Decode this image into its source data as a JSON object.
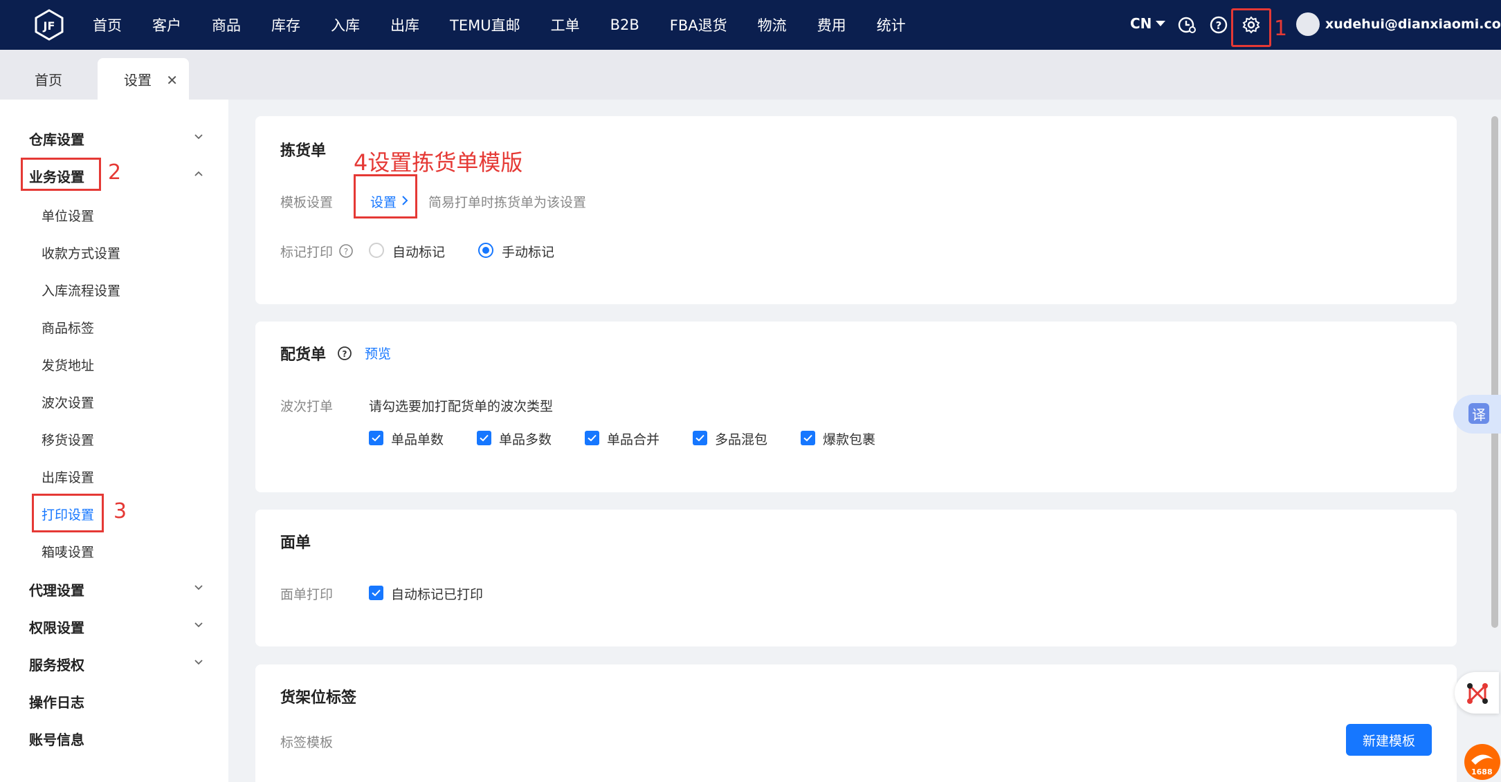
{
  "colors": {
    "nav_bg": "#0b1f4f",
    "accent": "#1677ff",
    "annotation": "#e53935"
  },
  "nav": {
    "logo_icon": "jf-logo-icon",
    "items": [
      "首页",
      "客户",
      "商品",
      "库存",
      "入库",
      "出库",
      "TEMU直邮",
      "工单",
      "B2B",
      "FBA退货",
      "物流",
      "费用",
      "统计"
    ]
  },
  "topright": {
    "lang": "CN",
    "icons": [
      "clock-icon",
      "help-icon",
      "gear-icon"
    ],
    "user": "xudehui@dianxiaomi.com"
  },
  "tabs": {
    "home": "首页",
    "settings": "设置",
    "close": "✕"
  },
  "sidebar": {
    "groups": {
      "warehouse": "仓库设置",
      "business": "业务设置",
      "agent": "代理设置",
      "permission": "权限设置",
      "service": "服务授权",
      "log": "操作日志",
      "account": "账号信息"
    },
    "items": [
      "单位设置",
      "收款方式设置",
      "入库流程设置",
      "商品标签",
      "发货地址",
      "波次设置",
      "移货设置",
      "出库设置",
      "打印设置",
      "箱唛设置"
    ]
  },
  "annotations": {
    "a1": "1",
    "a2": "2",
    "a3": "3",
    "a4": "4设置拣货单模版"
  },
  "picking": {
    "title": "拣货单",
    "template_label": "模板设置",
    "template_link": "设置",
    "template_hint": "简易打单时拣货单为该设置",
    "mark_label": "标记打印",
    "radio_auto": "自动标记",
    "radio_manual": "手动标记"
  },
  "distribution": {
    "title": "配货单",
    "preview": "预览",
    "wave_label": "波次打单",
    "wave_hint": "请勾选要加打配货单的波次类型",
    "checks": [
      "单品单数",
      "单品多数",
      "单品合并",
      "多品混包",
      "爆款包裹"
    ]
  },
  "waybill": {
    "title": "面单",
    "print_label": "面单打印",
    "auto_mark": "自动标记已打印"
  },
  "shelf": {
    "title": "货架位标签",
    "template_label": "标签模板",
    "new_button": "新建模板"
  },
  "floating": {
    "translate": "译",
    "badge_1688": "1688"
  }
}
